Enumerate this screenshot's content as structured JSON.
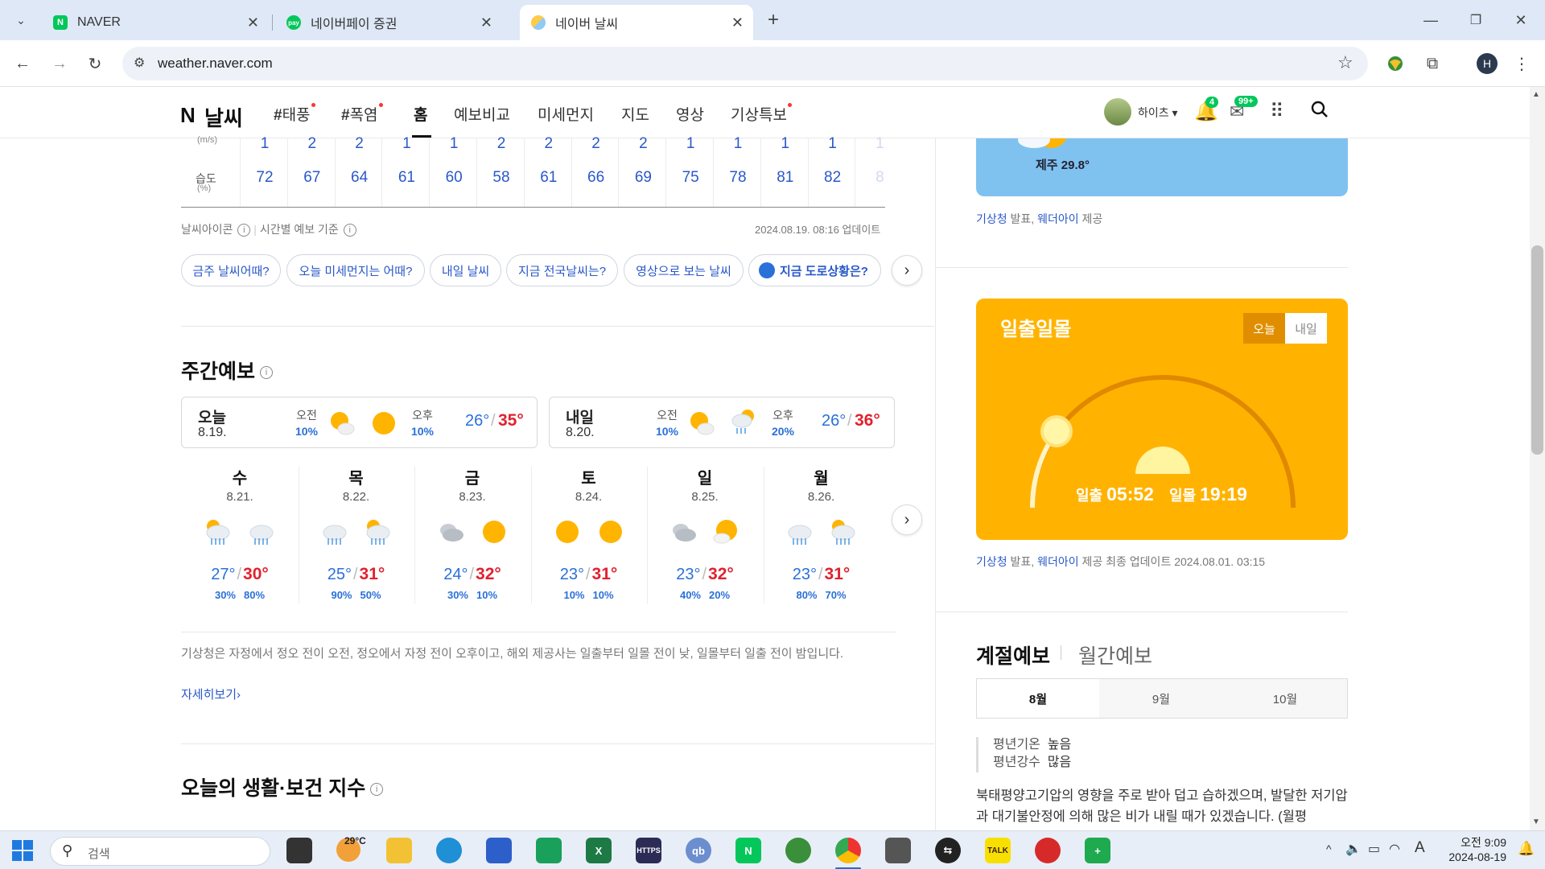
{
  "browser": {
    "tabs": [
      {
        "title": "NAVER",
        "favicon": "N"
      },
      {
        "title": "네이버페이 증권",
        "favicon": "pay"
      },
      {
        "title": "네이버 날씨",
        "favicon": ""
      }
    ],
    "url": "weather.naver.com",
    "profile_initial": "H"
  },
  "header": {
    "logo_n": "N",
    "logo_text": "날씨",
    "nav": [
      {
        "label": "태풍",
        "hash": "#",
        "dot": true
      },
      {
        "label": "폭염",
        "hash": "#",
        "dot": true
      },
      {
        "label": "홈",
        "hash": "",
        "dot": false
      },
      {
        "label": "예보비교",
        "hash": "",
        "dot": false
      },
      {
        "label": "미세먼지",
        "hash": "",
        "dot": false
      },
      {
        "label": "지도",
        "hash": "",
        "dot": false
      },
      {
        "label": "영상",
        "hash": "",
        "dot": false
      },
      {
        "label": "기상특보",
        "hash": "",
        "dot": true
      }
    ],
    "user_name": "하이츠",
    "notif_count": "4",
    "mail_count": "99+"
  },
  "hourly": {
    "wind_label": "(m/s)",
    "wind": [
      "1",
      "2",
      "2",
      "1",
      "1",
      "2",
      "2",
      "2",
      "2",
      "1",
      "1",
      "1",
      "1",
      "1"
    ],
    "humidity_label": "습도",
    "humidity_unit": "(%)",
    "humidity": [
      "72",
      "67",
      "64",
      "61",
      "60",
      "58",
      "61",
      "66",
      "69",
      "75",
      "78",
      "81",
      "82",
      "8"
    ],
    "footer_left1": "날씨아이콘",
    "footer_left2": "시간별 예보 기준",
    "updated": "2024.08.19. 08:16 업데이트"
  },
  "chips": [
    "금주 날씨어때?",
    "오늘 미세먼지는 어때?",
    "내일 날씨",
    "지금 전국날씨는?",
    "영상으로 보는 날씨",
    "지금 도로상황은?"
  ],
  "weekly": {
    "title": "주간예보",
    "today": {
      "day": "오늘",
      "date": "8.19.",
      "am_label": "오전",
      "am_pct": "10%",
      "pm_label": "오후",
      "pm_pct": "10%",
      "low": "26°",
      "high": "35°"
    },
    "tomorrow": {
      "day": "내일",
      "date": "8.20.",
      "am_label": "오전",
      "am_pct": "10%",
      "pm_label": "오후",
      "pm_pct": "20%",
      "low": "26°",
      "high": "36°"
    },
    "days": [
      {
        "day": "수",
        "date": "8.21.",
        "low": "27°",
        "high": "30°",
        "am": "30%",
        "pm": "80%",
        "icons": [
          "suncloudrain",
          "rain"
        ]
      },
      {
        "day": "목",
        "date": "8.22.",
        "low": "25°",
        "high": "31°",
        "am": "90%",
        "pm": "50%",
        "icons": [
          "rain",
          "suncloudrain"
        ]
      },
      {
        "day": "금",
        "date": "8.23.",
        "low": "24°",
        "high": "32°",
        "am": "30%",
        "pm": "10%",
        "icons": [
          "cloud",
          "sun"
        ]
      },
      {
        "day": "토",
        "date": "8.24.",
        "low": "23°",
        "high": "31°",
        "am": "10%",
        "pm": "10%",
        "icons": [
          "sun",
          "sun"
        ]
      },
      {
        "day": "일",
        "date": "8.25.",
        "low": "23°",
        "high": "32°",
        "am": "40%",
        "pm": "20%",
        "icons": [
          "cloud",
          "suncloud"
        ]
      },
      {
        "day": "월",
        "date": "8.26.",
        "low": "23°",
        "high": "31°",
        "am": "80%",
        "pm": "70%",
        "icons": [
          "rain",
          "suncloudrain"
        ]
      }
    ],
    "note": "기상청은 자정에서 정오 전이 오전, 정오에서 자정 전이 오후이고, 해외 제공사는 일출부터 일몰 전이 낮, 일몰부터 일출 전이 밤입니다.",
    "more": "자세히보기"
  },
  "life_title": "오늘의 생활·보건 지수",
  "right": {
    "jeju_temp": "제주 29.8°",
    "source1_a": "기상청",
    "source1_b": "발표,",
    "source1_c": "웨더아이",
    "source1_d": "제공",
    "sun_title": "일출일몰",
    "toggle_today": "오늘",
    "toggle_tomorrow": "내일",
    "sunrise_label": "일출",
    "sunrise": "05:52",
    "sunset_label": "일몰",
    "sunset": "19:19",
    "source2_tail": "제공 최종 업데이트 2024.08.01. 03:15",
    "season_title": "계절예보",
    "monthly_title": "월간예보",
    "months": [
      "8월",
      "9월",
      "10월"
    ],
    "avg_temp_label": "평년기온",
    "avg_temp_val": "높음",
    "avg_rain_label": "평년강수",
    "avg_rain_val": "많음",
    "desc": "북태평양고기압의 영향을 주로 받아 덥고 습하겠으며, 발달한 저기압과 대기불안정에 의해 많은 비가 내릴 때가 있겠습니다. (월평"
  },
  "taskbar": {
    "search_placeholder": "검색",
    "weather_temp": "29°C",
    "time": "오전 9:09",
    "date": "2024-08-19"
  },
  "colors": {
    "accent_blue": "#2a70d9",
    "accent_red": "#e0222f",
    "sun_card": "#ffb300",
    "sky_card": "#7fc2f0"
  }
}
